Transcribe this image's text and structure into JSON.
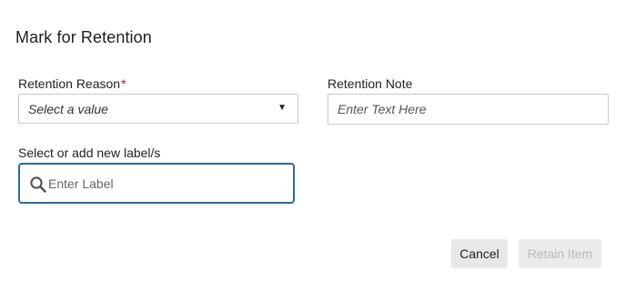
{
  "dialog": {
    "title": "Mark for Retention"
  },
  "retention_reason": {
    "label": "Retention Reason",
    "required_marker": "*",
    "selected_value": "Select a value",
    "caret": "▼"
  },
  "retention_note": {
    "label": "Retention Note",
    "placeholder": "Enter Text Here",
    "value": ""
  },
  "labels": {
    "label": "Select or add new label/s",
    "placeholder": "Enter Label",
    "value": ""
  },
  "actions": {
    "cancel_label": "Cancel",
    "retain_label": "Retain Item",
    "retain_enabled": false
  },
  "colors": {
    "required": "#c8102e",
    "focus_border": "#2b6d8f",
    "button_bg": "#e8e8e8",
    "disabled_text": "#b8b8b8"
  }
}
